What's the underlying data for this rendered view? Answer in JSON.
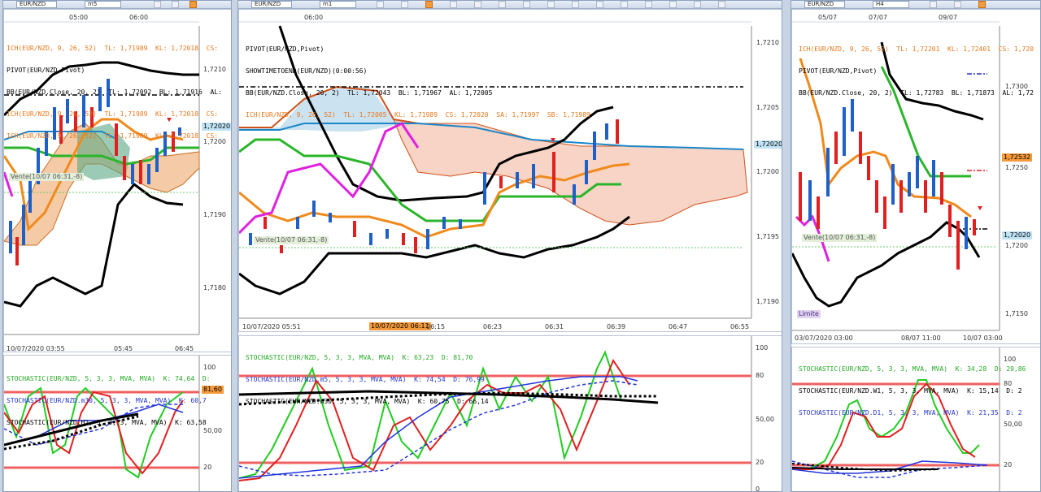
{
  "windows": [
    {
      "symbol": "EUR/NZD",
      "timeframe": "m5",
      "price_labels": [
        "1,7210",
        "1,7200",
        "1,7190",
        "1,7180"
      ],
      "current_price": "1,72020",
      "top_times": [
        "05:00",
        "06:00"
      ],
      "bottom_times": [
        "10/07/2020 03:55",
        "05:45",
        "06:45"
      ],
      "legend": [
        {
          "text": "ICH(EUR/NZD, 9, 26, 52)  TL: 1,71989  KL: 1,72018  CS:",
          "color": "#e8781c"
        },
        {
          "text": "PIVOT(EUR/NZD,Pivot)",
          "color": "#000000"
        },
        {
          "text": "BB(EUR/NZD.Close, 20, 2)  TL: 1,72092  BL: 1,71916  AL:",
          "color": "#000000"
        },
        {
          "text": "ICH(EUR/NZD, 9, 26, 52)  TL: 1,71989  KL: 1,72018  CS:",
          "color": "#e8781c"
        },
        {
          "text": "ICH(EUR/NZD, 9, 26, 52)  TL: 1,71989  KL: 1,72018  CS:",
          "color": "#e8781c"
        }
      ],
      "order_tag": "Vente(10/07 06:31,-8)",
      "stoch_legend": [
        {
          "text": "STOCHASTIC(EUR/NZD, 5, 3, 3, MVA, MVA)  K: 74,64  D:",
          "color": "#22aa22"
        },
        {
          "text": "STOCHASTIC(EUR/NZD.m30, 5, 3, 3, MVA, MVA)  K: 60,7",
          "color": "#2233cc"
        },
        {
          "text": "STOCHASTIC(EUR/NZD.H2, 5, 3, 3, MVA, MVA)  K: 63,58",
          "color": "#000000"
        }
      ],
      "stoch_levels": [
        "100",
        "81,60",
        "50,00",
        "20"
      ],
      "stoch_badge": "81,60"
    },
    {
      "symbol": "EUR/NZD",
      "timeframe": "m1",
      "price_labels": [
        "1,7210",
        "1,7205",
        "1,7200",
        "1,7195",
        "1,7190"
      ],
      "current_price": "1,72020",
      "top_times": [
        "06:00"
      ],
      "bottom_times": [
        "10/07/2020 05:51",
        "06:15",
        "06:23",
        "06:31",
        "06:39",
        "06:47",
        "06:55"
      ],
      "cursor_time": "10/07/2020 06:11",
      "legend": [
        {
          "text": "PIVOT(EUR/NZD,Pivot)",
          "color": "#000000"
        },
        {
          "text": "SHOWTIMETOEND(EUR/NZD)(0:00:56)",
          "color": "#000000"
        },
        {
          "text": "BB(EUR/NZD.Close, 20, 2)  TL: 1,72043  BL: 1,71967  AL: 1,72005",
          "color": "#000000"
        },
        {
          "text": "ICH(EUR/NZD, 9, 26, 52)  TL: 1,72005  KL: 1,71989  CS: 1,72020  SA: 1,71997  SB: 1,71989",
          "color": "#e8781c"
        }
      ],
      "order_tag": "Vente(10/07 06:31,-8)",
      "stoch_legend": [
        {
          "text": "STOCHASTIC(EUR/NZD, 5, 3, 3, MVA, MVA)  K: 63,23  D: 81,70",
          "color": "#22aa22"
        },
        {
          "text": "STOCHASTIC(EUR/NZD.m5, 5, 3, 3, MVA, MVA)  K: 74,54  D: 76,99",
          "color": "#2233cc"
        },
        {
          "text": "STOCHASTIC(EUR/NZD.m30, 5, 3, 3, MVA, MVA)  K: 60,75  D: 66,14",
          "color": "#000000"
        }
      ],
      "stoch_levels": [
        "100",
        "80",
        "50,00",
        "20",
        "0"
      ]
    },
    {
      "symbol": "EUR/NZD",
      "timeframe": "H4",
      "price_labels": [
        "1,7300",
        "1,7250",
        "1,7200",
        "1,7150"
      ],
      "current_price": "1,72020",
      "price_badge2": "1,72532",
      "top_times": [
        "05/07",
        "07/07",
        "09/07"
      ],
      "bottom_times": [
        "03/07/2020 03:00",
        "08/07 11:00",
        "10/07 03:00"
      ],
      "legend": [
        {
          "text": "ICH(EUR/NZD, 9, 26, 52)  TL: 1,72201  KL: 1,72401  CS: 1,720",
          "color": "#e8781c"
        },
        {
          "text": "PIVOT(EUR/NZD,Pivot)",
          "color": "#000000"
        },
        {
          "text": "BB(EUR/NZD.Close, 20, 2)  TL: 1,72783  BL: 1,71873  AL: 1,72",
          "color": "#000000"
        }
      ],
      "order_tag": "Vente(10/07 06:31,-8)",
      "limit_tag": "Limite",
      "stoch_legend": [
        {
          "text": "STOCHASTIC(EUR/NZD, 5, 3, 3, MVA, MVA)  K: 34,28  D: 29,86",
          "color": "#22aa22"
        },
        {
          "text": "STOCHASTIC(EUR/NZD.W1, 5, 3, 3, MVA, MVA)  K: 15,14  D: 2",
          "color": "#000000"
        },
        {
          "text": "STOCHASTIC(EUR/NZD.D1, 5, 3, 3, MVA, MVA)  K: 21,35  D: 2",
          "color": "#2233cc"
        }
      ],
      "stoch_levels": [
        "100",
        "80",
        "50,00",
        "20"
      ]
    }
  ]
}
